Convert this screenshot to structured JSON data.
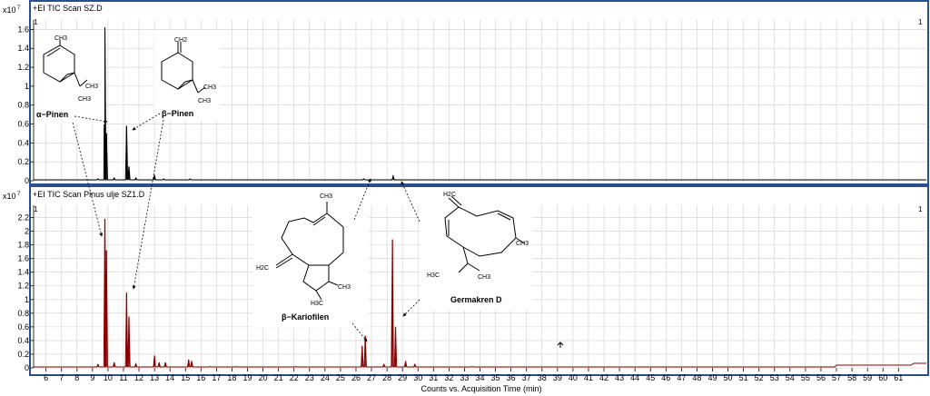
{
  "chart_data": [
    {
      "type": "line",
      "title": "+EI TIC Scan SZ.D",
      "y_multiplier": "x10",
      "y_exponent": "7",
      "panel_number": "1",
      "ylim": [
        0,
        1.7
      ],
      "yticks": [
        "0",
        "0.2",
        "0.4",
        "0.6",
        "0.8",
        "1",
        "1.2",
        "1.4",
        "1.6"
      ],
      "xlim": [
        5.2,
        62.8
      ],
      "color": "#000000",
      "peaks": [
        {
          "x": 9.35,
          "y": 0.02
        },
        {
          "x": 9.8,
          "y": 1.62
        },
        {
          "x": 9.9,
          "y": 0.5
        },
        {
          "x": 10.4,
          "y": 0.03
        },
        {
          "x": 11.2,
          "y": 0.58
        },
        {
          "x": 11.35,
          "y": 0.15
        },
        {
          "x": 11.8,
          "y": 0.03
        },
        {
          "x": 13.0,
          "y": 0.06
        },
        {
          "x": 13.6,
          "y": 0.02
        },
        {
          "x": 15.3,
          "y": 0.02
        },
        {
          "x": 26.5,
          "y": 0.02
        },
        {
          "x": 28.4,
          "y": 0.05
        }
      ]
    },
    {
      "type": "line",
      "title": "+EI TIC Scan Pinus ulje SZ1.D",
      "y_multiplier": "x10",
      "y_exponent": "7",
      "panel_number": "1",
      "ylim": [
        0,
        2.38
      ],
      "yticks": [
        "0",
        "0.2",
        "0.4",
        "0.6",
        "0.8",
        "1",
        "1.2",
        "1.4",
        "1.6",
        "1.8",
        "2",
        "2.2"
      ],
      "xlim": [
        5.2,
        62.8
      ],
      "color": "#8b0000",
      "xlabel": "Counts vs. Acquisition Time (min)",
      "xticks": [
        6,
        7,
        8,
        9,
        10,
        11,
        12,
        13,
        14,
        15,
        16,
        17,
        18,
        19,
        20,
        21,
        22,
        23,
        24,
        25,
        26,
        27,
        28,
        29,
        30,
        31,
        32,
        33,
        34,
        35,
        36,
        37,
        38,
        39,
        40,
        41,
        42,
        43,
        44,
        45,
        46,
        47,
        48,
        49,
        50,
        51,
        52,
        53,
        54,
        55,
        56,
        57,
        58,
        59,
        60,
        61
      ],
      "peaks": [
        {
          "x": 9.35,
          "y": 0.05
        },
        {
          "x": 9.8,
          "y": 2.18
        },
        {
          "x": 9.9,
          "y": 1.72
        },
        {
          "x": 10.4,
          "y": 0.08
        },
        {
          "x": 11.2,
          "y": 1.1
        },
        {
          "x": 11.35,
          "y": 0.75
        },
        {
          "x": 11.8,
          "y": 0.06
        },
        {
          "x": 13.0,
          "y": 0.18
        },
        {
          "x": 13.3,
          "y": 0.08
        },
        {
          "x": 13.7,
          "y": 0.08
        },
        {
          "x": 15.2,
          "y": 0.12
        },
        {
          "x": 15.4,
          "y": 0.1
        },
        {
          "x": 16.6,
          "y": 0.02
        },
        {
          "x": 18.3,
          "y": 0.02
        },
        {
          "x": 22.1,
          "y": 0.02
        },
        {
          "x": 26.4,
          "y": 0.32
        },
        {
          "x": 26.6,
          "y": 0.47
        },
        {
          "x": 27.8,
          "y": 0.05
        },
        {
          "x": 28.35,
          "y": 1.88
        },
        {
          "x": 28.55,
          "y": 0.6
        },
        {
          "x": 29.2,
          "y": 0.1
        },
        {
          "x": 29.8,
          "y": 0.05
        },
        {
          "x": 33.5,
          "y": 0.02
        }
      ]
    }
  ],
  "annotations": {
    "alpha_pinene": {
      "name": "α−Pinen",
      "ch3_top": "CH3",
      "ch3_a": "CH3",
      "ch3_b": "CH3"
    },
    "beta_pinene": {
      "name": "β−Pinen",
      "ch2": "CH2",
      "ch3_a": "CH3",
      "ch3_b": "CH3"
    },
    "beta_caryophyllene": {
      "name": "β−Kariofilen",
      "ch3": "CH3",
      "h2c": "H2C",
      "h3c": "H3C",
      "ch3_b": "CH3"
    },
    "germacrene_d": {
      "name": "Germakren D",
      "h2c": "H2C",
      "ch3": "CH3",
      "h3c": "H3C",
      "ch3_b": "CH3"
    }
  }
}
